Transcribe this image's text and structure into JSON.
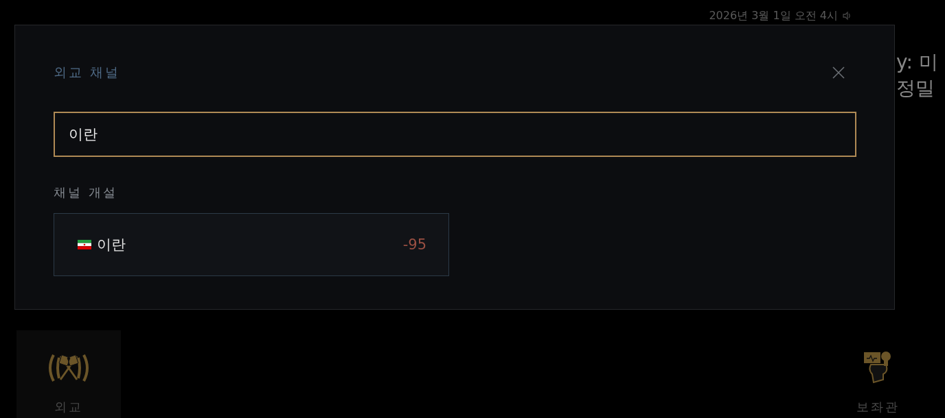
{
  "background": {
    "timestamp": "2026년 3월 1일 오전 4시",
    "headline_lines": [
      "y: 미",
      "정밀"
    ]
  },
  "dialog": {
    "title": "외교 채널",
    "search": {
      "value": "이란"
    },
    "section_label": "채널 개설",
    "results": [
      {
        "name": "이란",
        "value": "-95"
      }
    ]
  },
  "nav": [
    {
      "label": "외교",
      "selected": true
    },
    {
      "label": "보좌관",
      "selected": false
    }
  ]
}
